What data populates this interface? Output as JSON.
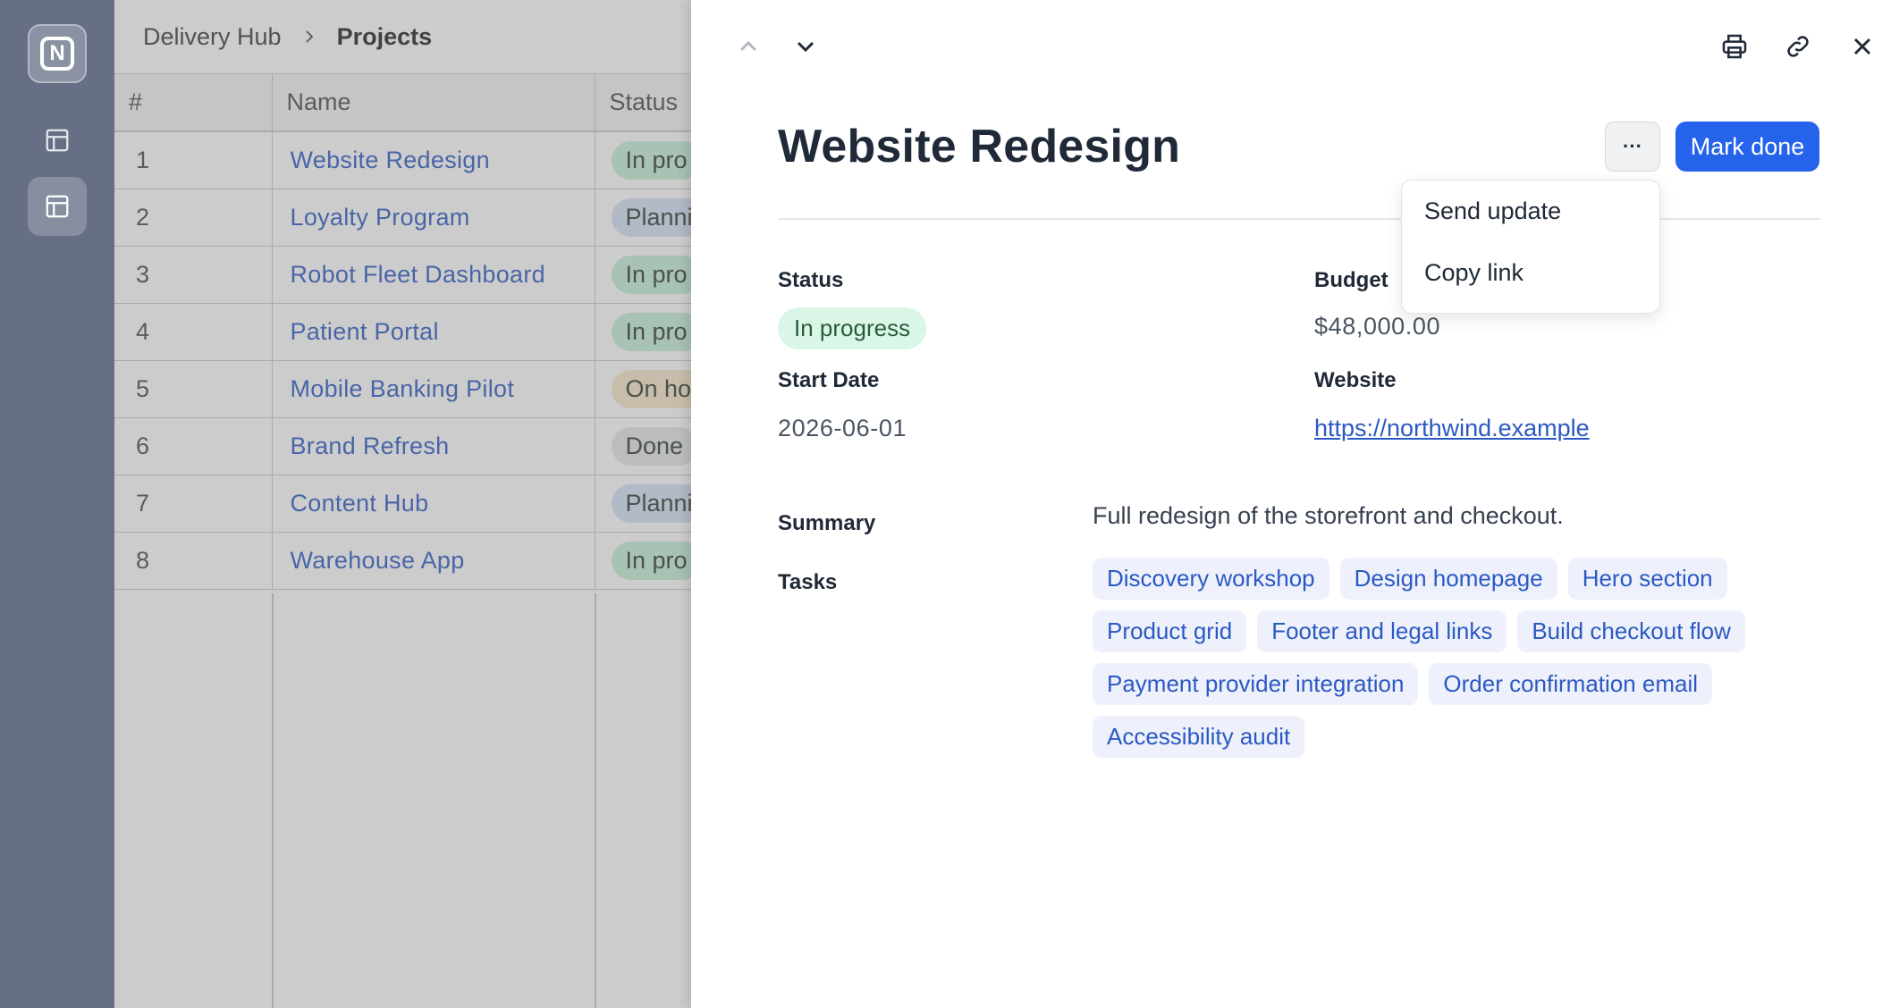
{
  "app": {
    "logo_letter": "N"
  },
  "breadcrumb": {
    "parent": "Delivery Hub",
    "current": "Projects"
  },
  "table": {
    "headers": [
      "#",
      "Name",
      "Status"
    ],
    "rows": [
      {
        "num": "1",
        "name": "Website Redesign",
        "status": "In pro",
        "status_kind": "progress"
      },
      {
        "num": "2",
        "name": "Loyalty Program",
        "status": "Planni",
        "status_kind": "planning"
      },
      {
        "num": "3",
        "name": "Robot Fleet Dashboard",
        "status": "In pro",
        "status_kind": "progress"
      },
      {
        "num": "4",
        "name": "Patient Portal",
        "status": "In pro",
        "status_kind": "progress"
      },
      {
        "num": "5",
        "name": "Mobile Banking Pilot",
        "status": "On ho",
        "status_kind": "hold"
      },
      {
        "num": "6",
        "name": "Brand Refresh",
        "status": "Done",
        "status_kind": "done"
      },
      {
        "num": "7",
        "name": "Content Hub",
        "status": "Planni",
        "status_kind": "planning"
      },
      {
        "num": "8",
        "name": "Warehouse App",
        "status": "In pro",
        "status_kind": "progress"
      }
    ]
  },
  "drawer": {
    "title": "Website Redesign",
    "more_label": "···",
    "mark_done_label": "Mark done",
    "menu": {
      "items": [
        "Send update",
        "Copy link"
      ]
    },
    "fields": {
      "status_label": "Status",
      "status_value": "In progress",
      "budget_label": "Budget",
      "budget_value": "$48,000.00",
      "start_label": "Start Date",
      "start_value": "2026-06-01",
      "website_label": "Website",
      "website_value": "https://northwind.example",
      "summary_label": "Summary",
      "summary_value": "Full redesign of the storefront and checkout.",
      "tasks_label": "Tasks"
    },
    "tasks": [
      "Discovery workshop",
      "Design homepage",
      "Hero section",
      "Product grid",
      "Footer and legal links",
      "Build checkout flow",
      "Payment provider integration",
      "Order confirmation email",
      "Accessibility audit"
    ]
  },
  "colors": {
    "accent": "#2563eb",
    "link": "#2b59c3",
    "rail": "#676f85"
  }
}
